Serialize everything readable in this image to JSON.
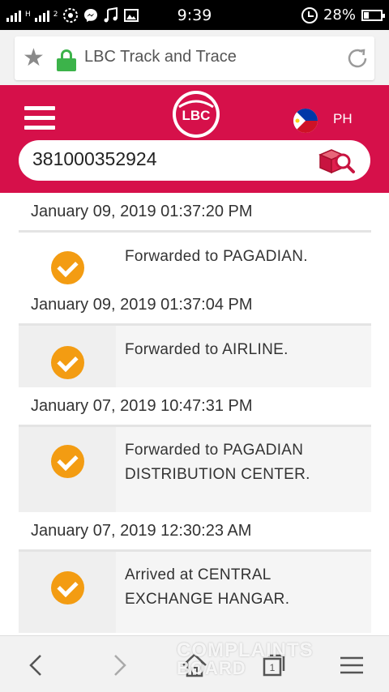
{
  "status_bar": {
    "carrier_labels": [
      "H",
      "2"
    ],
    "time": "9:39",
    "battery": "28%",
    "icons": [
      "signal-icon",
      "signal-icon",
      "app-icon",
      "messenger-icon",
      "music-icon",
      "image-icon",
      "alarm-icon",
      "battery-icon"
    ]
  },
  "browser": {
    "url_text": "LBC Track and Trace",
    "icons": [
      "star-icon",
      "lock-icon",
      "refresh-icon"
    ]
  },
  "header": {
    "logo_text": "LBC",
    "country_code": "PH",
    "tracking_number": "381000352924",
    "brand_color": "#d6104a"
  },
  "events": [
    {
      "date": "January 09, 2019 01:37:20 PM",
      "lines": [
        "Forwarded to PAGADIAN."
      ]
    },
    {
      "date": "January 09, 2019 01:37:04 PM",
      "lines": [
        "Forwarded to AIRLINE."
      ]
    },
    {
      "date": "January 07, 2019 10:47:31 PM",
      "lines": [
        "Forwarded to PAGADIAN",
        "DISTRIBUTION CENTER."
      ]
    },
    {
      "date": "January 07, 2019 12:30:23 AM",
      "lines": [
        "Arrived at CENTRAL",
        "EXCHANGE HANGAR."
      ]
    }
  ],
  "status_color": "#f39c12",
  "bottom_nav": {
    "tab_count": "1",
    "watermark_line1": "COMPLAINTS",
    "watermark_line2": "BOARD"
  }
}
